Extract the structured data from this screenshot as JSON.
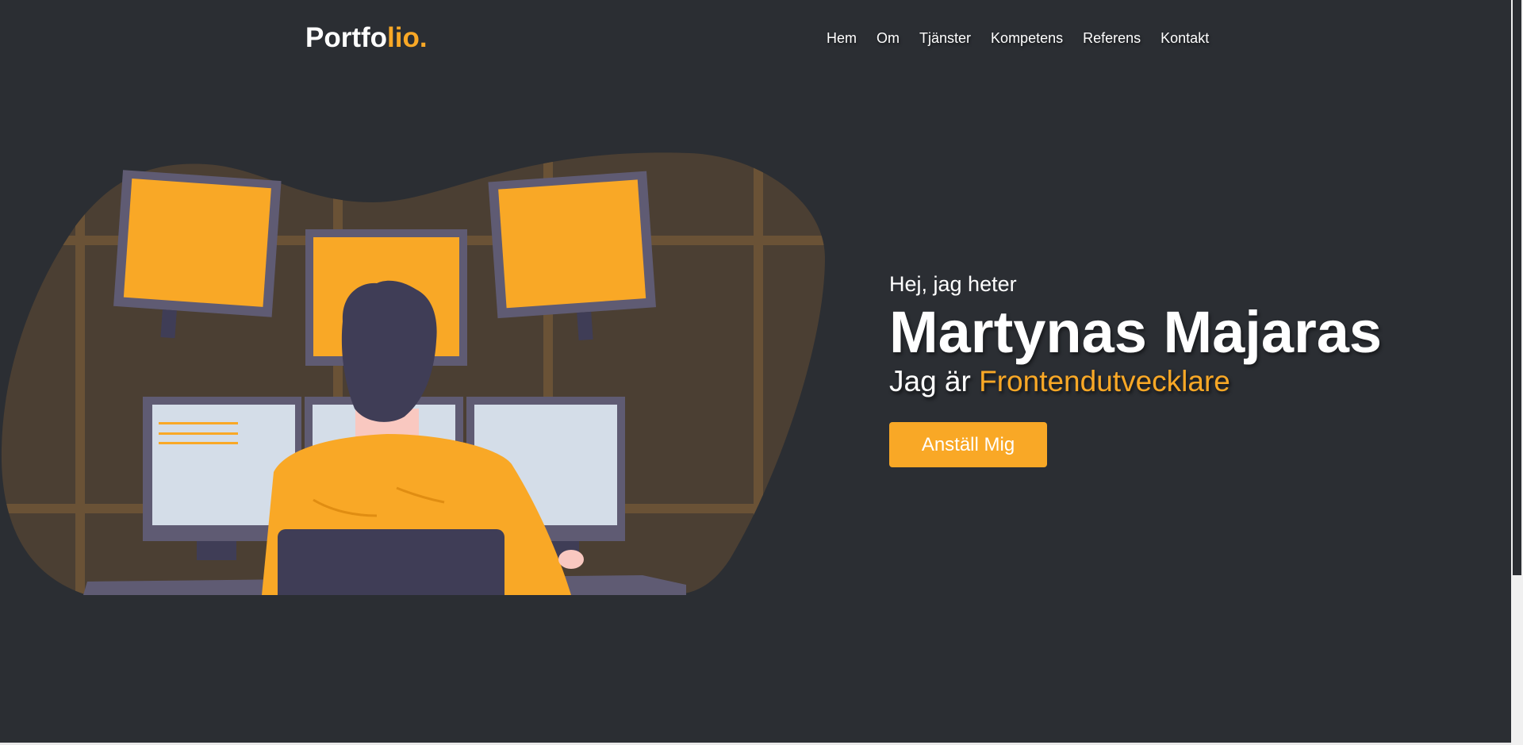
{
  "header": {
    "logo_main": "Portfo",
    "logo_accent": "lio.",
    "nav": [
      "Hem",
      "Om",
      "Tjänster",
      "Kompetens",
      "Referens",
      "Kontakt"
    ]
  },
  "hero": {
    "greeting": "Hej, jag heter",
    "name": "Martynas Majaras",
    "role_prefix": "Jag är",
    "role_accent": "Frontendutvecklare",
    "cta_label": "Anställ Mig",
    "illustration": "developer-at-multiple-monitors-illustration"
  },
  "colors": {
    "background": "#2b2e33",
    "accent": "#f9a826",
    "text": "#ffffff"
  }
}
